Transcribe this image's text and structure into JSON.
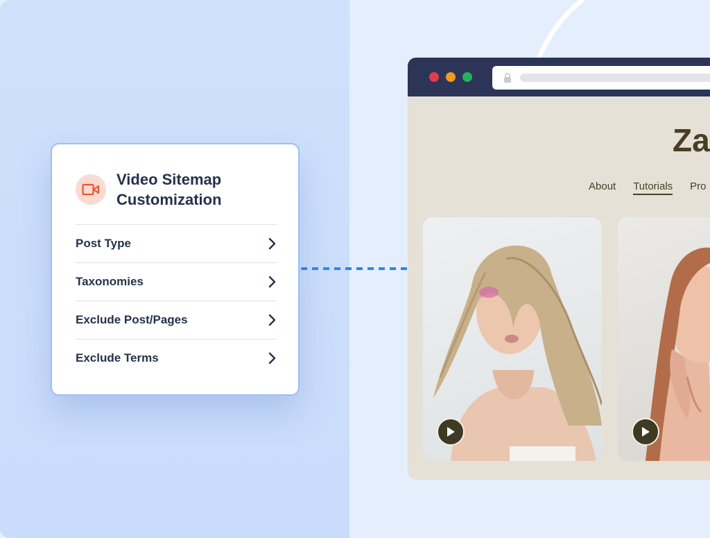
{
  "card": {
    "icon": "video-camera-icon",
    "title": "Video Sitemap Customization",
    "items": [
      {
        "label": "Post Type",
        "icon": "chevron-right-icon"
      },
      {
        "label": "Taxonomies",
        "icon": "chevron-right-icon"
      },
      {
        "label": "Exclude Post/Pages",
        "icon": "chevron-right-icon"
      },
      {
        "label": "Exclude Terms",
        "icon": "chevron-right-icon"
      }
    ]
  },
  "browser": {
    "window_controls": [
      "close",
      "minimize",
      "maximize"
    ],
    "site_title": "Za",
    "nav": [
      "About",
      "Tutorials",
      "Pro"
    ],
    "active_nav": "Tutorials",
    "videos": [
      {
        "play_icon": "play-icon"
      },
      {
        "play_icon": "play-icon"
      }
    ]
  },
  "colors": {
    "accent": "#2f86ea",
    "icon_accent": "#e8582c",
    "heading": "#26314b",
    "browser_chrome": "#2c3557",
    "site_text": "#4a3d26"
  }
}
